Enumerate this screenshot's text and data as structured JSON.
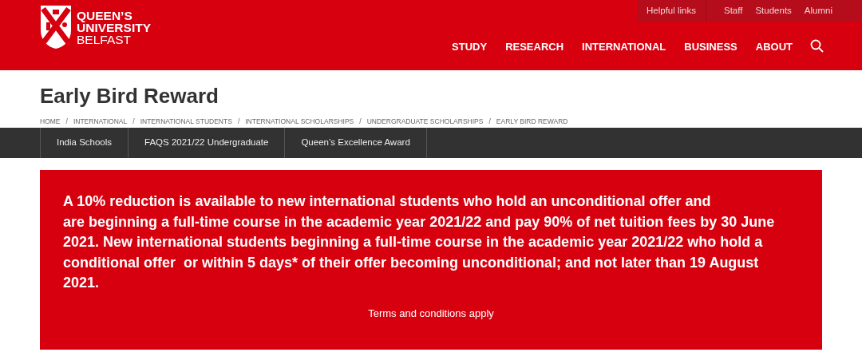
{
  "header": {
    "logo_lines": [
      "QUEEN’S",
      "UNIVERSITY",
      "BELFAST"
    ],
    "utility_links": [
      {
        "label": "Helpful links",
        "kind": "menu"
      },
      {
        "label": "Staff",
        "kind": "link"
      },
      {
        "label": "Students",
        "kind": "link"
      },
      {
        "label": "Alumni",
        "kind": "link"
      }
    ],
    "nav": [
      "STUDY",
      "RESEARCH",
      "INTERNATIONAL",
      "BUSINESS",
      "ABOUT"
    ]
  },
  "page": {
    "title": "Early Bird Reward",
    "breadcrumb": {
      "separator": "/",
      "items": [
        "HOME",
        "INTERNATIONAL",
        "INTERNATIONAL STUDENTS",
        "INTERNATIONAL SCHOLARSHIPS",
        "UNDERGRADUATE SCHOLARSHIPS",
        "EARLY BIRD REWARD"
      ]
    },
    "subnav": [
      "India Schools",
      "FAQS 2021/22 Undergraduate",
      "Queen’s Excellence Award"
    ],
    "notice": {
      "lines": [
        "A 10% reduction is available to new international students who hold an unconditional offer and",
        "are beginning a full-time course in the academic year 2021/22 and pay 90% of net tuition fees by 30 June",
        "2021. New international students beginning a full-time course in the academic year 2021/22 who hold a",
        "conditional offer  or within 5 days* of their offer becoming unconditional; and not later than 19 August",
        "2021."
      ],
      "footer": "Terms and conditions apply"
    }
  }
}
